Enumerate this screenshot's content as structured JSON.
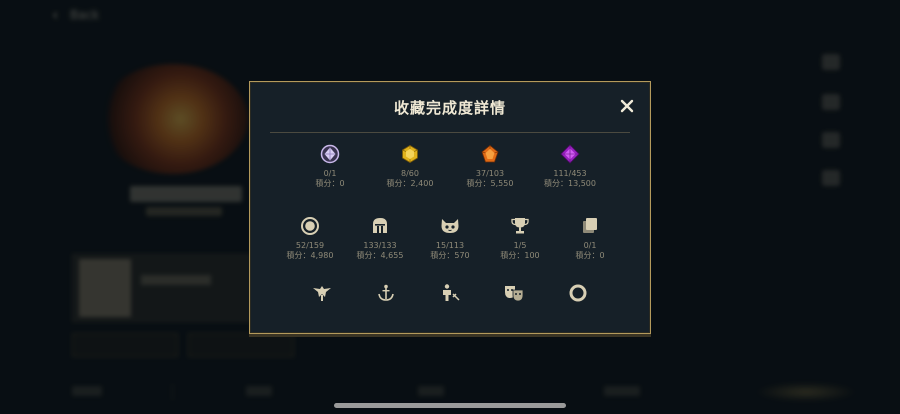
{
  "background": {
    "back_label": "Back"
  },
  "modal": {
    "title": "收藏完成度詳情",
    "rows": [
      [
        {
          "icon": "lavender-gem-icon",
          "count": "0/1",
          "score": "積分：0",
          "color": "#c9b8ea"
        },
        {
          "icon": "gold-gem-icon",
          "count": "8/60",
          "score": "積分：2,400",
          "color": "#e0b21c"
        },
        {
          "icon": "orange-gem-icon",
          "count": "37/103",
          "score": "積分：5,550",
          "color": "#e06b16"
        },
        {
          "icon": "purple-gem-icon",
          "count": "111/453",
          "score": "積分：13,500",
          "color": "#b23ad6"
        }
      ],
      [
        {
          "icon": "ward-ring-icon",
          "count": "52/159",
          "score": "積分：4,980",
          "color": "#d8cfb4"
        },
        {
          "icon": "helmet-icon",
          "count": "133/133",
          "score": "積分：4,655",
          "color": "#d8cfb4"
        },
        {
          "icon": "poro-icon",
          "count": "15/113",
          "score": "積分：570",
          "color": "#d8cfb4"
        },
        {
          "icon": "trophy-icon",
          "count": "1/5",
          "score": "積分：100",
          "color": "#d8cfb4"
        },
        {
          "icon": "cards-icon",
          "count": "0/1",
          "score": "積分：0",
          "color": "#d8cfb4"
        }
      ]
    ],
    "bottom_icons": [
      "emblem-icon",
      "anchor-icon",
      "pose-icon",
      "masks-icon",
      "ring-icon"
    ]
  }
}
